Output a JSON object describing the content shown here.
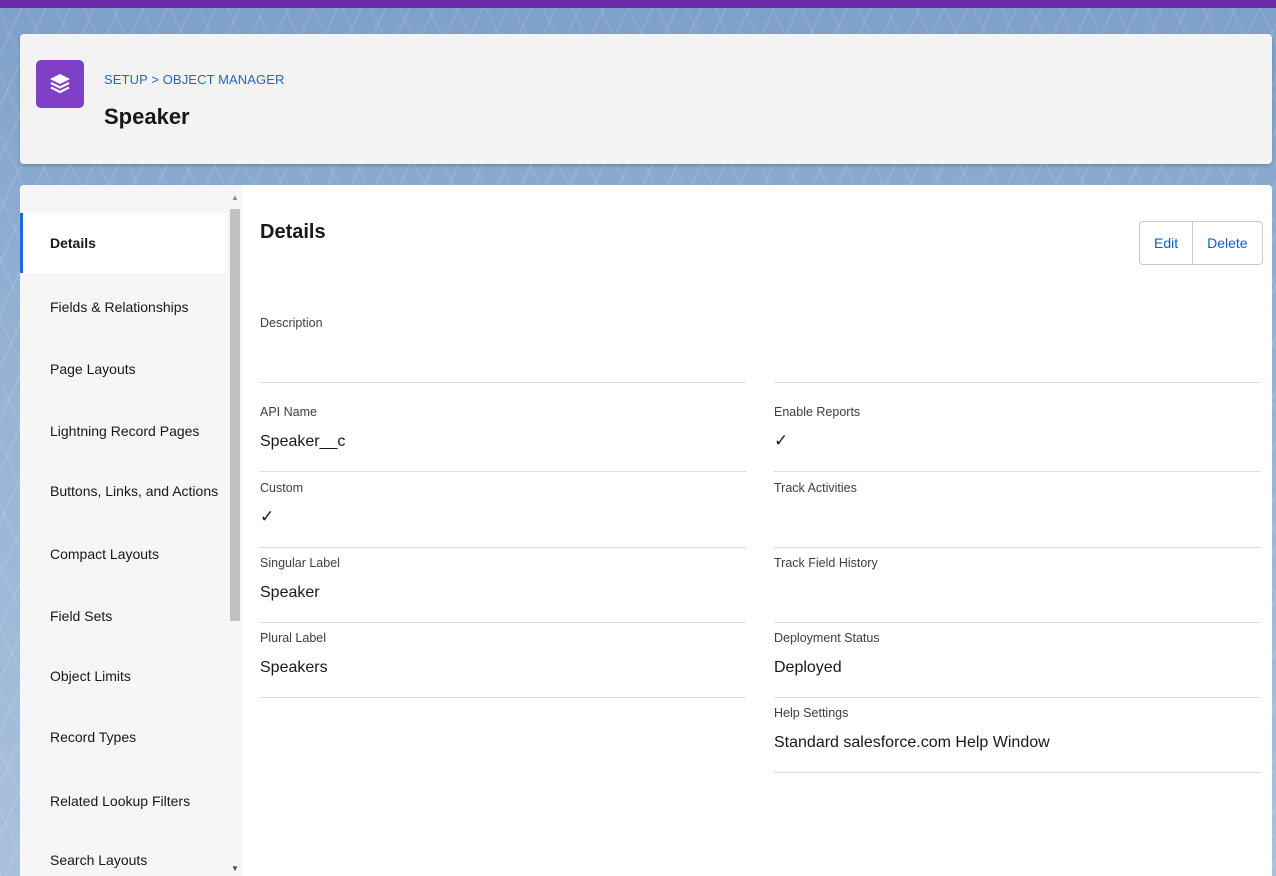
{
  "header": {
    "breadcrumb": "SETUP > OBJECT MANAGER",
    "title": "Speaker",
    "icon": "layers-icon",
    "icon_color": "#7f3fc6"
  },
  "sidebar": {
    "items": [
      {
        "label": "Details",
        "active": true
      },
      {
        "label": "Fields & Relationships"
      },
      {
        "label": "Page Layouts"
      },
      {
        "label": "Lightning Record Pages"
      },
      {
        "label": "Buttons, Links, and Actions"
      },
      {
        "label": "Compact Layouts"
      },
      {
        "label": "Field Sets"
      },
      {
        "label": "Object Limits"
      },
      {
        "label": "Record Types"
      },
      {
        "label": "Related Lookup Filters"
      },
      {
        "label": "Search Layouts"
      }
    ]
  },
  "main": {
    "section_title": "Details",
    "edit_label": "Edit",
    "delete_label": "Delete",
    "fields": {
      "description": {
        "label": "Description",
        "value": ""
      },
      "api_name": {
        "label": "API Name",
        "value": "Speaker__c"
      },
      "custom": {
        "label": "Custom",
        "value": "✓"
      },
      "singular_label": {
        "label": "Singular Label",
        "value": "Speaker"
      },
      "plural_label": {
        "label": "Plural Label",
        "value": "Speakers"
      },
      "enable_reports": {
        "label": "Enable Reports",
        "value": "✓"
      },
      "track_activities": {
        "label": "Track Activities",
        "value": ""
      },
      "track_field_history": {
        "label": "Track Field History",
        "value": ""
      },
      "deployment_status": {
        "label": "Deployment Status",
        "value": "Deployed"
      },
      "help_settings": {
        "label": "Help Settings",
        "value": "Standard salesforce.com Help Window"
      }
    }
  },
  "colors": {
    "accent": "#0b61c7",
    "brand_stripe": "#6a2aa8"
  }
}
